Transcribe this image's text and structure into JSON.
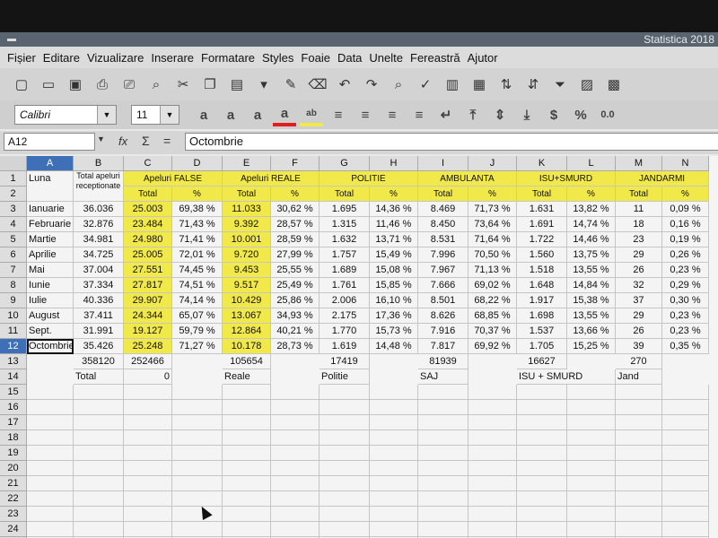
{
  "app": {
    "title": "Statistica 2018"
  },
  "menubar": [
    "Fișier",
    "Editare",
    "Vizualizare",
    "Inserare",
    "Formatare",
    "Styles",
    "Foaie",
    "Data",
    "Unelte",
    "Fereastră",
    "Ajutor"
  ],
  "toolbar": {
    "font_name": "Calibri",
    "font_size": "11",
    "currency_symbol": "$",
    "percent_symbol": "%",
    "decimal_label": "0.0"
  },
  "formula_bar": {
    "name_box": "A12",
    "fx": "fx",
    "sum": "Σ",
    "eq": "=",
    "content": "Octombrie"
  },
  "sheet": {
    "columns": [
      "A",
      "B",
      "C",
      "D",
      "E",
      "F",
      "G",
      "H",
      "I",
      "J",
      "K",
      "L",
      "M",
      "N"
    ],
    "rows": [
      "1",
      "2",
      "3",
      "4",
      "5",
      "6",
      "7",
      "8",
      "9",
      "10",
      "11",
      "12",
      "13",
      "14",
      "15",
      "16",
      "17",
      "18",
      "19",
      "20",
      "21",
      "22",
      "23",
      "24",
      "25"
    ],
    "selected_col": "A",
    "selected_row": "12",
    "header_row1": {
      "luna": "Luna",
      "total_apeluri": "Total apeluri receptionate",
      "apeluri_false": "Apeluri FALSE",
      "apeluri_reale": "Apeluri REALE",
      "politie": "POLITIE",
      "ambulanta": "AMBULANTA",
      "isu_smurd": "ISU+SMURD",
      "jandarmi": "JANDARMI"
    },
    "header_row2": {
      "total": "Total",
      "pct": "%"
    },
    "data_rows": [
      [
        "Ianuarie",
        "36.036",
        "25.003",
        "69,38 %",
        "11.033",
        "30,62 %",
        "1.695",
        "14,36 %",
        "8.469",
        "71,73 %",
        "1.631",
        "13,82 %",
        "11",
        "0,09 %"
      ],
      [
        "Februarie",
        "32.876",
        "23.484",
        "71,43 %",
        "9.392",
        "28,57 %",
        "1.315",
        "11,46 %",
        "8.450",
        "73,64 %",
        "1.691",
        "14,74 %",
        "18",
        "0,16 %"
      ],
      [
        "Martie",
        "34.981",
        "24.980",
        "71,41 %",
        "10.001",
        "28,59 %",
        "1.632",
        "13,71 %",
        "8.531",
        "71,64 %",
        "1.722",
        "14,46 %",
        "23",
        "0,19 %"
      ],
      [
        "Aprilie",
        "34.725",
        "25.005",
        "72,01 %",
        "9.720",
        "27,99 %",
        "1.757",
        "15,49 %",
        "7.996",
        "70,50 %",
        "1.560",
        "13,75 %",
        "29",
        "0,26 %"
      ],
      [
        "Mai",
        "37.004",
        "27.551",
        "74,45 %",
        "9.453",
        "25,55 %",
        "1.689",
        "15,08 %",
        "7.967",
        "71,13 %",
        "1.518",
        "13,55 %",
        "26",
        "0,23 %"
      ],
      [
        "Iunie",
        "37.334",
        "27.817",
        "74,51 %",
        "9.517",
        "25,49 %",
        "1.761",
        "15,85 %",
        "7.666",
        "69,02 %",
        "1.648",
        "14,84 %",
        "32",
        "0,29 %"
      ],
      [
        "Iulie",
        "40.336",
        "29.907",
        "74,14 %",
        "10.429",
        "25,86 %",
        "2.006",
        "16,10 %",
        "8.501",
        "68,22 %",
        "1.917",
        "15,38 %",
        "37",
        "0,30 %"
      ],
      [
        "August",
        "37.411",
        "24.344",
        "65,07 %",
        "13.067",
        "34,93 %",
        "2.175",
        "17,36 %",
        "8.626",
        "68,85 %",
        "1.698",
        "13,55 %",
        "29",
        "0,23 %"
      ],
      [
        "Sept.",
        "31.991",
        "19.127",
        "59,79 %",
        "12.864",
        "40,21 %",
        "1.770",
        "15,73 %",
        "7.916",
        "70,37 %",
        "1.537",
        "13,66 %",
        "26",
        "0,23 %"
      ],
      [
        "Octombrie",
        "35.426",
        "25.248",
        "71,27 %",
        "10.178",
        "28,73 %",
        "1.619",
        "14,48 %",
        "7.817",
        "69,92 %",
        "1.705",
        "15,25 %",
        "39",
        "0,35 %"
      ]
    ],
    "row13": {
      "b": "358120",
      "c": "252466",
      "e": "105654",
      "g": "17419",
      "i": "81939",
      "k": "16627",
      "m": "270"
    },
    "row14": {
      "b": "Total",
      "c": "0",
      "e": "Reale",
      "g": "Politie",
      "i": "SAJ",
      "k": "ISU + SMURD",
      "m": "Jand"
    }
  },
  "colors": {
    "highlight": "#f1e84a",
    "selection": "#3f6fb6"
  }
}
